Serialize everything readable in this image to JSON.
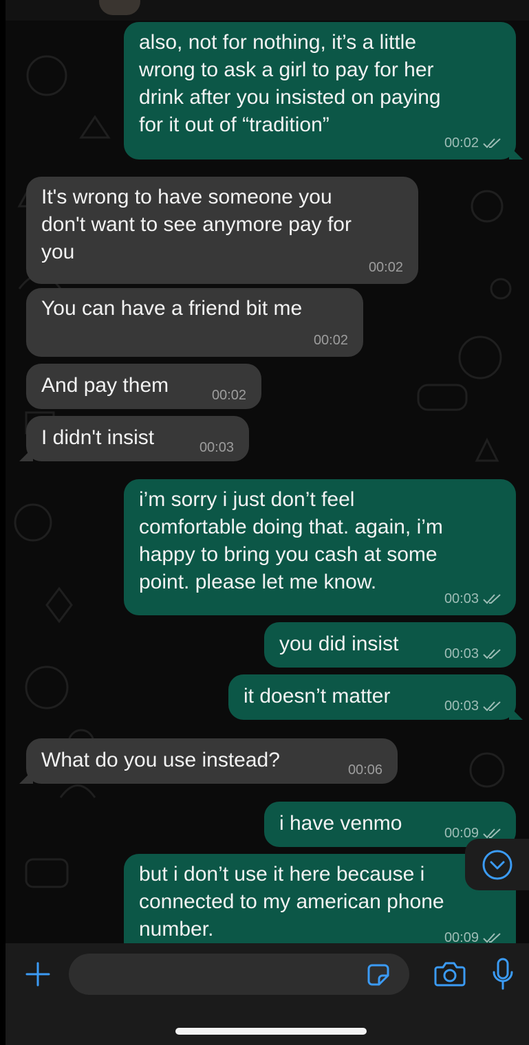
{
  "chat": {
    "messages": [
      {
        "dir": "out",
        "text": "also, not for nothing, it’s a little\nwrong to ask a girl to pay for her\ndrink after you insisted on paying\nfor it out of “tradition”",
        "time": "00:02",
        "read": true
      },
      {
        "dir": "in",
        "text": "It's wrong to have someone you\ndon't want to see anymore pay for\nyou",
        "time": "00:02"
      },
      {
        "dir": "in",
        "text": "You can have a friend bit me",
        "time": "00:02"
      },
      {
        "dir": "in",
        "text": "And pay them",
        "time": "00:02"
      },
      {
        "dir": "in",
        "text": "I didn't insist",
        "time": "00:03"
      },
      {
        "dir": "out",
        "text": "i’m sorry i just don’t feel\ncomfortable doing that. again, i’m\nhappy to bring you cash at some\npoint. please let me know.",
        "time": "00:03",
        "read": true
      },
      {
        "dir": "out",
        "text": "you did insist",
        "time": "00:03",
        "read": true
      },
      {
        "dir": "out",
        "text": "it doesn’t matter",
        "time": "00:03",
        "read": true
      },
      {
        "dir": "in",
        "text": "What do you use instead?",
        "time": "00:06"
      },
      {
        "dir": "out",
        "text": "i have venmo",
        "time": "00:09",
        "read": true
      },
      {
        "dir": "out",
        "text": "but i don’t use it here because i\nconnected to my american phone\nnumber.",
        "time": "00:09",
        "read": true
      }
    ]
  },
  "composer": {
    "input_value": "",
    "add_icon": "plus-icon",
    "sticker_icon": "sticker-icon",
    "camera_icon": "camera-icon",
    "mic_icon": "microphone-icon"
  },
  "scroll_button_icon": "chevron-down-circle-icon",
  "colors": {
    "outgoing_bubble": "#0c5747",
    "incoming_bubble": "#383838",
    "accent": "#3b9bf5",
    "background": "#0b0b0b"
  }
}
